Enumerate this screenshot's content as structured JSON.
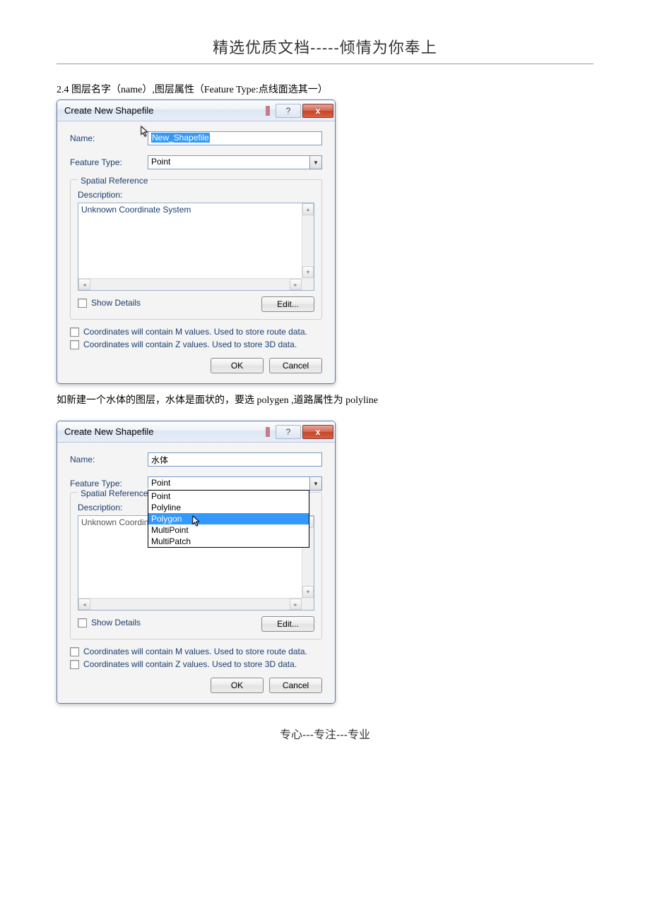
{
  "header": "精选优质文档-----倾情为你奉上",
  "section_24": "2.4 图层名字（name）,图层属性（Feature Type:点线面选其一）",
  "body_text": "如新建一个水体的图层，水体是面状的，要选 polygen ,道路属性为 polyline",
  "footer": "专心---专注---专业",
  "dialog_title": "Create New Shapefile",
  "labels": {
    "name": "Name:",
    "feature_type": "Feature Type:",
    "spatial_reference": "Spatial Reference",
    "description": "Description:",
    "show_details": "Show Details",
    "edit": "Edit...",
    "m_values": "Coordinates will contain M values. Used to store route data.",
    "z_values": "Coordinates will contain Z values. Used to store 3D data.",
    "ok": "OK",
    "cancel": "Cancel",
    "unknown_cs": "Unknown Coordinate System"
  },
  "dialog1": {
    "name_value": "New_Shapefile",
    "feature_type_value": "Point"
  },
  "dialog2": {
    "name_value": "水体",
    "feature_type_value": "Point",
    "options": [
      "Point",
      "Polyline",
      "Polygon",
      "MultiPoint",
      "MultiPatch"
    ],
    "highlighted_index": 2
  },
  "titlebar": {
    "help": "?",
    "close": "x"
  }
}
